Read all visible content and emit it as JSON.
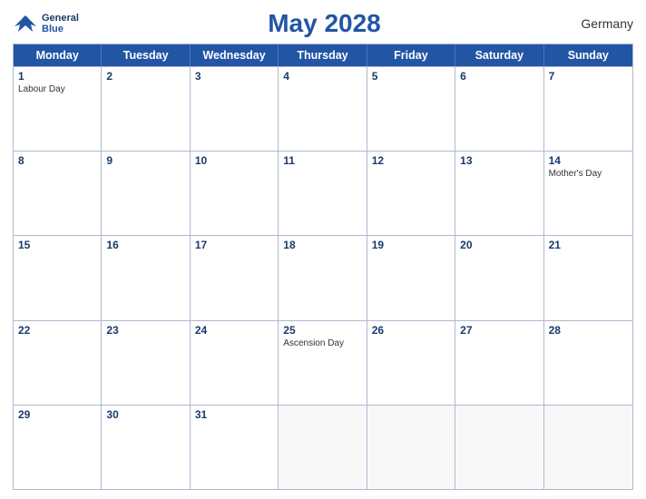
{
  "header": {
    "title": "May 2028",
    "country": "Germany",
    "logo_line1": "General",
    "logo_line2": "Blue"
  },
  "days": [
    "Monday",
    "Tuesday",
    "Wednesday",
    "Thursday",
    "Friday",
    "Saturday",
    "Sunday"
  ],
  "weeks": [
    [
      {
        "day": 1,
        "holiday": "Labour Day"
      },
      {
        "day": 2,
        "holiday": ""
      },
      {
        "day": 3,
        "holiday": ""
      },
      {
        "day": 4,
        "holiday": ""
      },
      {
        "day": 5,
        "holiday": ""
      },
      {
        "day": 6,
        "holiday": ""
      },
      {
        "day": 7,
        "holiday": ""
      }
    ],
    [
      {
        "day": 8,
        "holiday": ""
      },
      {
        "day": 9,
        "holiday": ""
      },
      {
        "day": 10,
        "holiday": ""
      },
      {
        "day": 11,
        "holiday": ""
      },
      {
        "day": 12,
        "holiday": ""
      },
      {
        "day": 13,
        "holiday": ""
      },
      {
        "day": 14,
        "holiday": "Mother's Day"
      }
    ],
    [
      {
        "day": 15,
        "holiday": ""
      },
      {
        "day": 16,
        "holiday": ""
      },
      {
        "day": 17,
        "holiday": ""
      },
      {
        "day": 18,
        "holiday": ""
      },
      {
        "day": 19,
        "holiday": ""
      },
      {
        "day": 20,
        "holiday": ""
      },
      {
        "day": 21,
        "holiday": ""
      }
    ],
    [
      {
        "day": 22,
        "holiday": ""
      },
      {
        "day": 23,
        "holiday": ""
      },
      {
        "day": 24,
        "holiday": ""
      },
      {
        "day": 25,
        "holiday": "Ascension Day"
      },
      {
        "day": 26,
        "holiday": ""
      },
      {
        "day": 27,
        "holiday": ""
      },
      {
        "day": 28,
        "holiday": ""
      }
    ],
    [
      {
        "day": 29,
        "holiday": ""
      },
      {
        "day": 30,
        "holiday": ""
      },
      {
        "day": 31,
        "holiday": ""
      },
      {
        "day": null,
        "holiday": ""
      },
      {
        "day": null,
        "holiday": ""
      },
      {
        "day": null,
        "holiday": ""
      },
      {
        "day": null,
        "holiday": ""
      }
    ]
  ]
}
